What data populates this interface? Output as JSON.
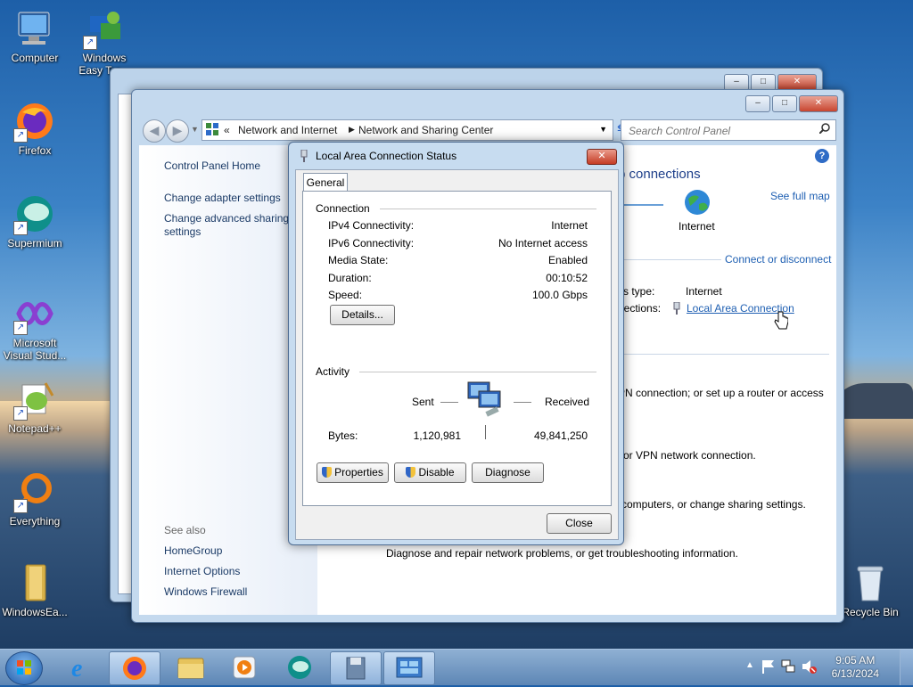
{
  "desktop": {
    "icons": [
      {
        "label": "Computer"
      },
      {
        "label": "Windows Easy Tra..."
      },
      {
        "label": "Firefox"
      },
      {
        "label": "Supermium"
      },
      {
        "label": "Microsoft Visual Stud..."
      },
      {
        "label": "Notepad++"
      },
      {
        "label": "Everything"
      },
      {
        "label": "WindowsEa..."
      },
      {
        "label": "Recycle Bin"
      }
    ]
  },
  "explorer": {
    "address": {
      "chevrons": "«",
      "crumb1": "Network and Internet",
      "crumb2": "Network and Sharing Center"
    },
    "search_placeholder": "Search Control Panel",
    "help": "?",
    "left_links": {
      "home": "Control Panel Home",
      "adapter": "Change adapter settings",
      "advanced_line1": "Change advanced sharing",
      "advanced_line2": "settings",
      "see_also": "See also",
      "homegroup": "HomeGroup",
      "internet_options": "Internet Options",
      "firewall": "Windows Firewall"
    },
    "main": {
      "heading_tail": "p connections",
      "see_full_map": "See full map",
      "internet": "Internet",
      "connect_disconnect": "Connect or disconnect",
      "access_type_label": "ss type:",
      "access_type_value": "Internet",
      "connections_label": "nections:",
      "connection_link": "Local Area Connection",
      "line1": "PN connection; or set up a router or access",
      "line2": "or VPN network connection.",
      "line3": "computers, or change sharing settings.",
      "line4": "Diagnose and repair network problems, or get troubleshooting information."
    }
  },
  "dialog": {
    "title": "Local Area Connection Status",
    "close_glyph": "✕",
    "tab": "General",
    "connection_group": "Connection",
    "rows": [
      {
        "label": "IPv4 Connectivity:",
        "value": "Internet"
      },
      {
        "label": "IPv6 Connectivity:",
        "value": "No Internet access"
      },
      {
        "label": "Media State:",
        "value": "Enabled"
      },
      {
        "label": "Duration:",
        "value": "00:10:52"
      },
      {
        "label": "Speed:",
        "value": "100.0 Gbps"
      }
    ],
    "details_btn": "Details...",
    "activity_group": "Activity",
    "sent": "Sent",
    "received": "Received",
    "bytes_label": "Bytes:",
    "bytes_sent": "1,120,981",
    "bytes_received": "49,841,250",
    "properties_btn": "Properties",
    "disable_btn": "Disable",
    "diagnose_btn": "Diagnose",
    "close_btn": "Close"
  },
  "taskbar": {
    "clock_time": "9:05 AM",
    "clock_date": "6/13/2024"
  }
}
